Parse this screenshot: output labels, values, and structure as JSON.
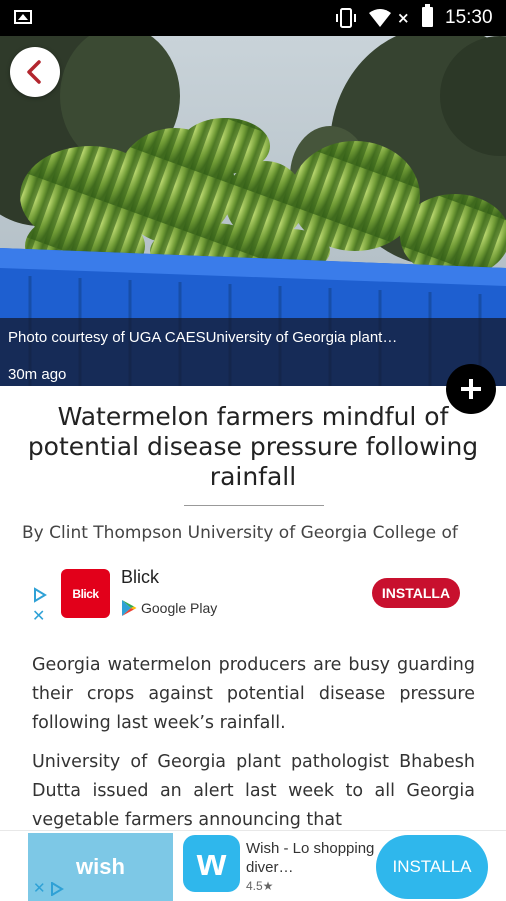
{
  "status_bar": {
    "time": "15:30",
    "no_signal_mark": "×"
  },
  "hero": {
    "caption": "Photo courtesy of UGA CAESUniversity of Georgia plant…",
    "time_ago": "30m ago"
  },
  "article": {
    "title": "Watermelon farmers mindful of potential disease pressure following rainfall",
    "byline": "By Clint Thompson University of Georgia College of",
    "paragraphs": [
      "Georgia watermelon producers are busy guarding their crops against potential disease pressure following last week’s rainfall.",
      "University of Georgia plant pathologist Bhabesh Dutta issued an alert last week to all Georgia vegetable farmers announcing that"
    ]
  },
  "inline_ad": {
    "logo_text": "Blick",
    "app_name": "Blick",
    "store_label": "Google Play",
    "install_label": "INSTALLA",
    "close_mark": "✕",
    "brand_color": "#e2001a",
    "button_color": "#c8102e"
  },
  "bottom_ad": {
    "banner_text": "wish",
    "logo_text": "w",
    "title": "Wish - Lo shopping diver…",
    "rating": "4.5★",
    "install_label": "INSTALLA",
    "close_mark": "✕",
    "accent_color": "#2fb7ec"
  }
}
